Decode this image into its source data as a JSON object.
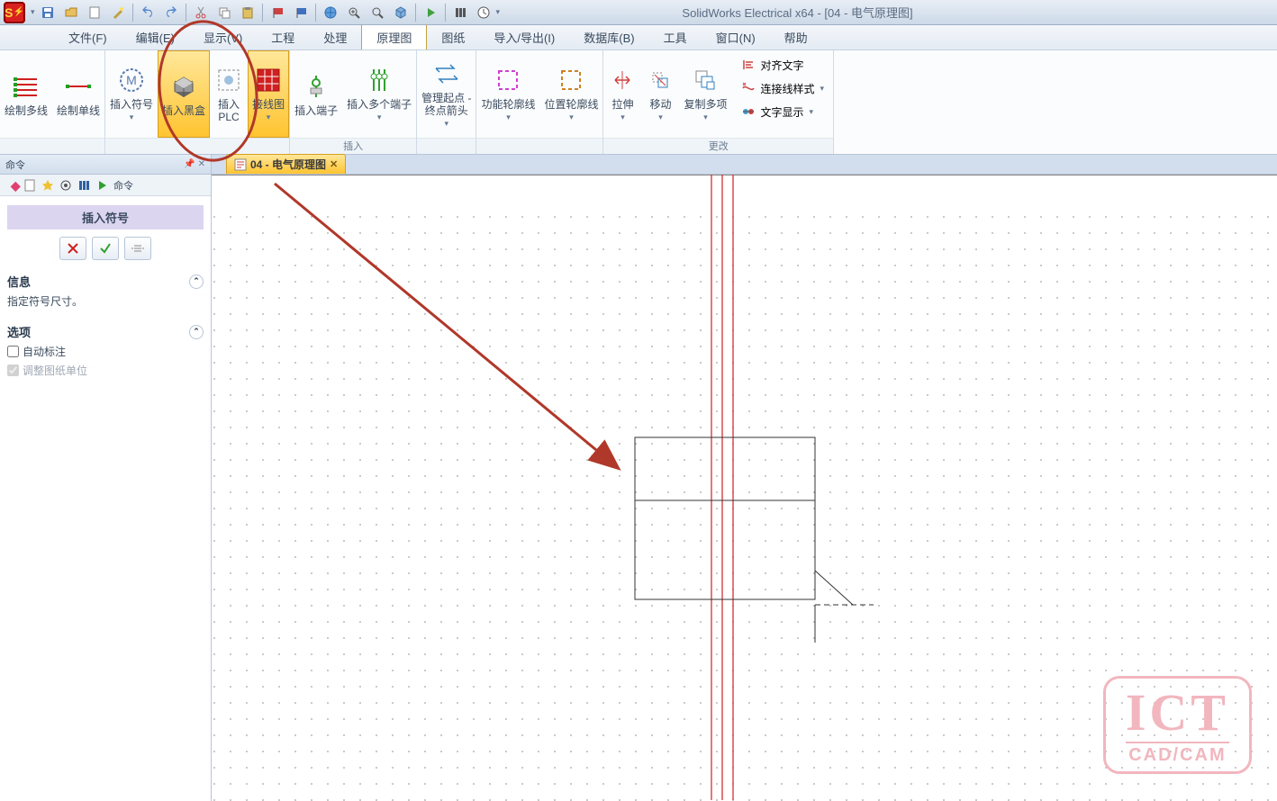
{
  "title": "SolidWorks Electrical x64 - [04 - 电气原理图]",
  "menubar": [
    "文件(F)",
    "编辑(E)",
    "显示(V)",
    "工程",
    "处理",
    "原理图",
    "图纸",
    "导入/导出(I)",
    "数据库(B)",
    "工具",
    "窗口(N)",
    "帮助"
  ],
  "menubar_active": 5,
  "ribbon_groups": [
    {
      "label": "",
      "items": [
        {
          "name": "draw-multi",
          "label": "绘制多线",
          "icon": "multiwire"
        },
        {
          "name": "draw-single",
          "label": "绘制单线",
          "icon": "singlewire"
        }
      ]
    },
    {
      "label": "",
      "items": [
        {
          "name": "insert-symbol",
          "label": "插入符号",
          "icon": "symbolM",
          "dd": true
        },
        {
          "name": "insert-blackbox",
          "label": "插入黑盒",
          "icon": "blackbox",
          "hl": true
        },
        {
          "name": "insert-plc",
          "label": "插入\nPLC",
          "icon": "plc"
        },
        {
          "name": "wiring-diagram",
          "label": "接线图",
          "icon": "grid",
          "hl": true,
          "dd": true
        }
      ]
    },
    {
      "label": "插入",
      "items": [
        {
          "name": "insert-terminal",
          "label": "插入端子",
          "icon": "terminal"
        },
        {
          "name": "insert-multi-terminal",
          "label": "插入多个端子",
          "icon": "multiterm",
          "dd": true
        }
      ]
    },
    {
      "label": "",
      "items": [
        {
          "name": "manage-origin",
          "label": "管理起点 -\n终点箭头",
          "icon": "arrows",
          "dd": true
        }
      ]
    },
    {
      "label": "",
      "items": [
        {
          "name": "func-outline",
          "label": "功能轮廓线",
          "icon": "func-outline",
          "dd": true
        },
        {
          "name": "loc-outline",
          "label": "位置轮廓线",
          "icon": "loc-outline",
          "dd": true
        }
      ]
    },
    {
      "label": "更改",
      "items": [
        {
          "name": "stretch",
          "label": "拉伸",
          "icon": "stretch",
          "dd": true
        },
        {
          "name": "move",
          "label": "移动",
          "icon": "move",
          "dd": true
        },
        {
          "name": "copy-multi",
          "label": "复制多项",
          "icon": "copy",
          "dd": true
        }
      ],
      "side": [
        {
          "name": "align-text",
          "label": "对齐文字",
          "icon": "align"
        },
        {
          "name": "wire-style",
          "label": "连接线样式",
          "icon": "wirestyle",
          "dd": true
        },
        {
          "name": "text-display",
          "label": "文字显示",
          "icon": "textdisp",
          "dd": true
        }
      ]
    }
  ],
  "side_title": "命令",
  "side_toolstrip_last": "命令",
  "panel": {
    "title": "插入符号",
    "info_head": "信息",
    "info_text": "指定符号尺寸。",
    "opts_head": "选项",
    "auto_label": "自动标注",
    "adjust_label": "调整图纸单位"
  },
  "doctab": {
    "label": "04 - 电气原理图"
  },
  "watermark": {
    "main": "ICT",
    "sub": "CAD/CAM"
  },
  "qat_icons": [
    "save",
    "folder",
    "page",
    "wiz",
    "undo",
    "redo",
    "cut",
    "copy",
    "paste",
    "flag-r",
    "flag-b",
    "globe",
    "zoom-in",
    "zoom-fit",
    "cube",
    "play",
    "bars",
    "clock"
  ]
}
